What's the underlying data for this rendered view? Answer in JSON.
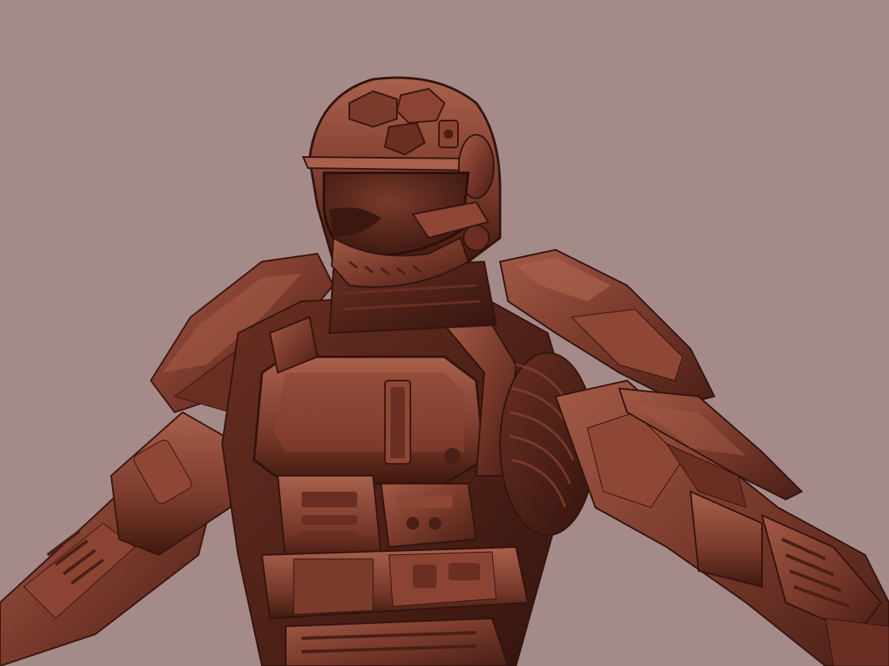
{
  "scene": {
    "subject": "armored-soldier-sculpt",
    "colors": {
      "background": "#a48a88",
      "armor_base": "#7a3a2c",
      "armor_light": "#a35a46",
      "armor_dark": "#4a1f16",
      "armor_shadow": "#33140e",
      "visor": "#5a2519"
    }
  }
}
